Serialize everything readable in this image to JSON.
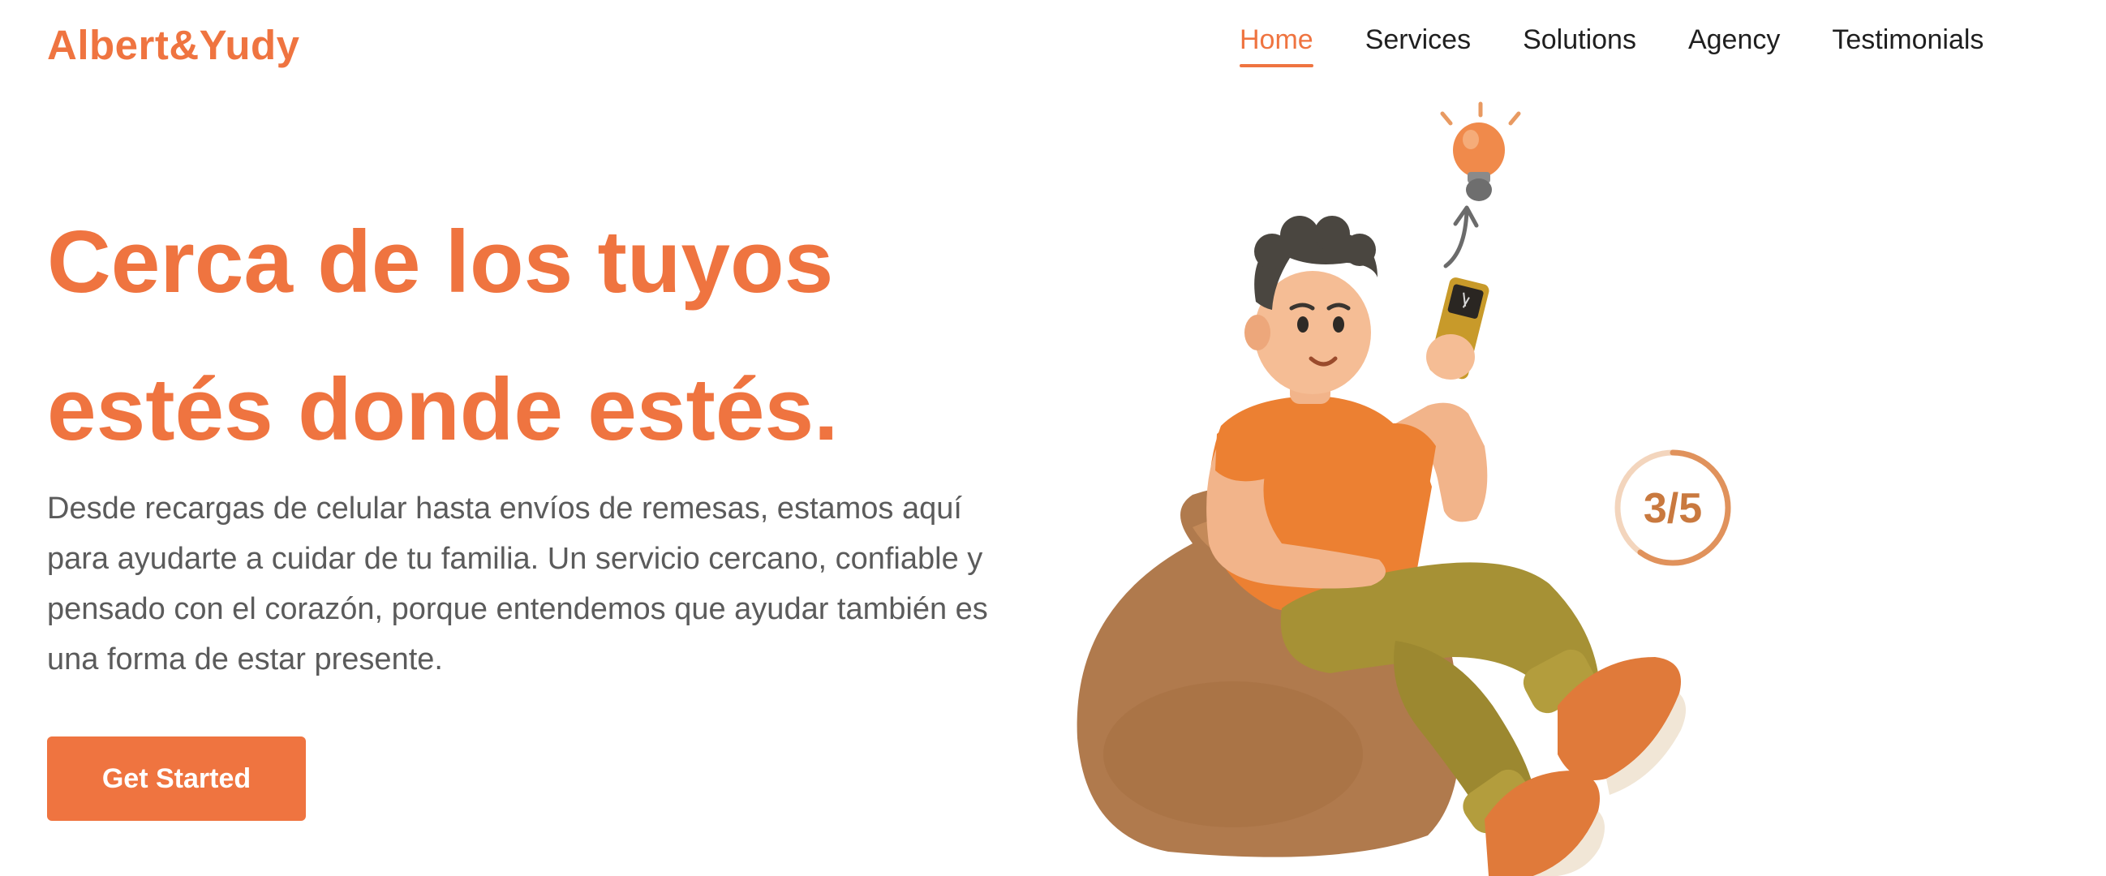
{
  "brand": {
    "name": "Albert&Yudy",
    "color": "#ef7440"
  },
  "nav": {
    "items": [
      {
        "label": "Home",
        "active": true
      },
      {
        "label": "Services",
        "active": false
      },
      {
        "label": "Solutions",
        "active": false
      },
      {
        "label": "Agency",
        "active": false
      },
      {
        "label": "Testimonials",
        "active": false
      }
    ]
  },
  "hero": {
    "title_line1": "Cerca de los tuyos",
    "title_line2": "estés donde estés.",
    "description": "Desde recargas de celular hasta envíos de remesas, estamos aquí para ayudarte a cuidar de tu familia. Un servicio cercano, confiable y pensado con el corazón, porque entendemos que ayudar también es una forma de estar presente.",
    "cta_label": "Get Started"
  },
  "illustration": {
    "progress_label": "3/5",
    "progress_fraction": 0.6,
    "icons": [
      "lightbulb-icon",
      "arrow-up-icon",
      "smartphone-icon"
    ]
  },
  "colors": {
    "accent": "#ef7440",
    "text_dark": "#1f1f1f",
    "text_muted": "#5b5b5b"
  }
}
